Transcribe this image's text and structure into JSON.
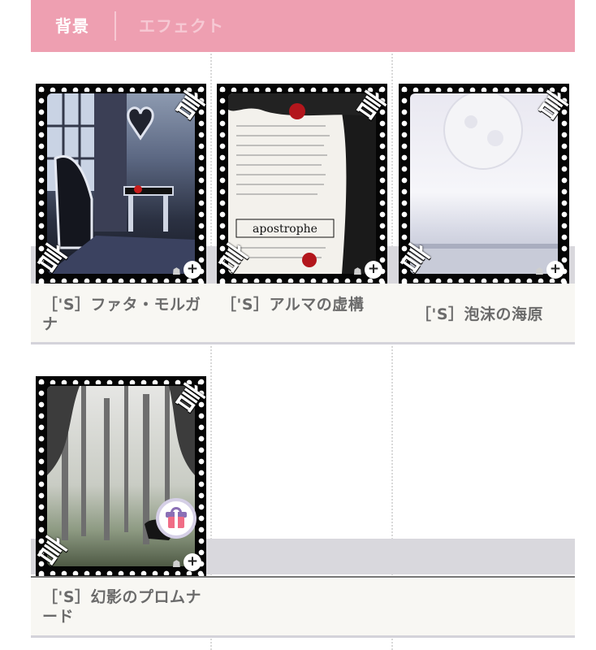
{
  "tabs": {
    "background": "背景",
    "effect": "エフェクト"
  },
  "colors": {
    "tab_bar": "#ee9fb1",
    "active_tab_text": "#ffffff",
    "inactive_tab_text": "#f6c9d4",
    "title_text": "#6b6b6b"
  },
  "items": [
    {
      "title": "［'S］ファタ・モルガナ",
      "corner_glyph": "言",
      "zoom_icon": "+"
    },
    {
      "title": "［'S］アルマの虚構",
      "corner_glyph": "言",
      "zoom_icon": "+",
      "image_text": "apostrophe"
    },
    {
      "title": "［'S］泡沫の海原",
      "corner_glyph": "言",
      "zoom_icon": "+"
    },
    {
      "title": "［'S］幻影のプロムナード",
      "corner_glyph": "言",
      "zoom_icon": "+",
      "badge": "gift-icon"
    }
  ]
}
